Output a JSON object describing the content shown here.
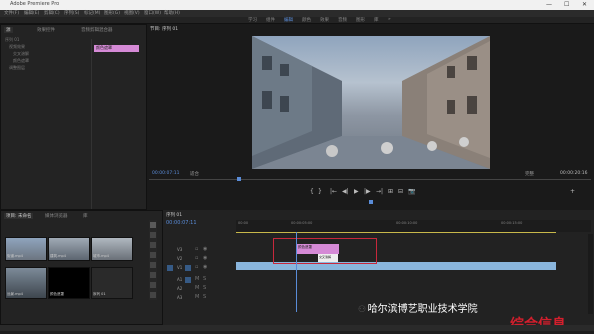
{
  "window": {
    "title": "Adobe Premiere Pro",
    "minimize": "—",
    "maximize": "☐",
    "close": "✕"
  },
  "menu": [
    "文件(F)",
    "编辑(E)",
    "剪辑(C)",
    "序列(S)",
    "标记(M)",
    "图形(G)",
    "视图(V)",
    "窗口(W)",
    "帮助(H)"
  ],
  "workspace_tabs": [
    "学习",
    "组件",
    "编辑",
    "颜色",
    "效果",
    "音频",
    "图形",
    "库",
    "»"
  ],
  "left_panel": {
    "tabs": [
      "源",
      "效果控件",
      "音频剪辑混合器"
    ],
    "tree_items": [
      "序列 01",
      "视频效果",
      "交叉溶解",
      "颜色遮罩",
      "调整图层"
    ],
    "selected_clip": "颜色遮罩"
  },
  "program_monitor": {
    "tab": "节目: 序列 01",
    "timecode_left": "00:00:07:11",
    "fit": "适合",
    "quality": "完整",
    "timecode_right": "00:00:20:16"
  },
  "playback": [
    "{",
    "}",
    "|←",
    "◀|",
    "▶",
    "|▶",
    "→|",
    "⊞",
    "⊟",
    "📷",
    "+"
  ],
  "project_panel": {
    "tabs": [
      "项目: 未命名",
      "媒体浏览器",
      "库"
    ],
    "clips": [
      "街道.mp4",
      "建筑.mp4",
      "城市.mp4",
      "远景.mp4",
      "颜色遮罩",
      "序列 01"
    ]
  },
  "timeline": {
    "tab": "序列 01",
    "timecode": "00:00:07:11",
    "ruler": [
      "00:00",
      "00:00:05:00",
      "00:00:10:00",
      "00:00:15:00"
    ],
    "video_tracks": [
      "V3",
      "V2",
      "V1"
    ],
    "audio_tracks": [
      "A1",
      "A2",
      "A3"
    ],
    "pink_clip_label": "颜色遮罩",
    "white_clip_label": "交叉溶解"
  },
  "watermark": {
    "text": "哈尔滨博艺职业技术学院",
    "logo_text": "综合信息"
  },
  "colors": {
    "pink": "#d58ad6",
    "blue_clip": "#8ab6dd",
    "red_box": "#c8283c",
    "accent": "#5a8cd8"
  }
}
